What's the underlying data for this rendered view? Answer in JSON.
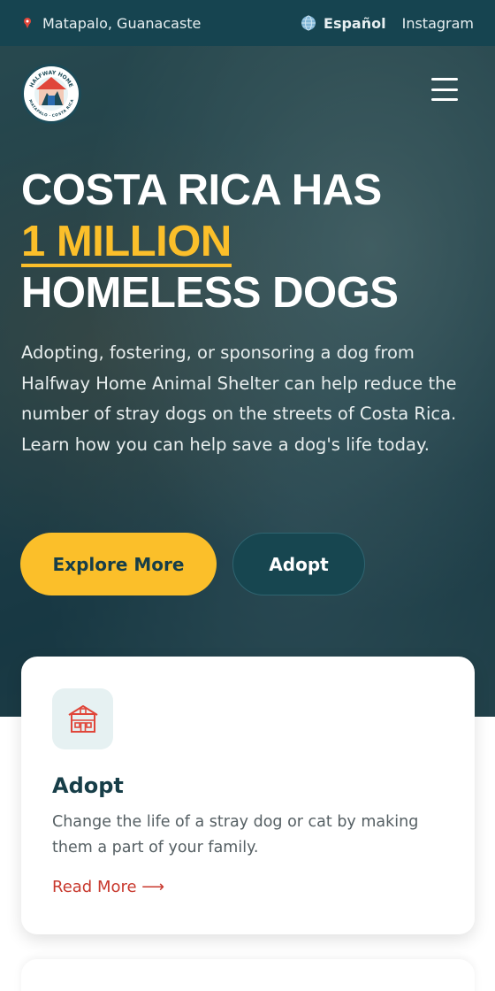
{
  "topbar": {
    "location": "Matapalo, Guanacaste",
    "language": "Español",
    "social": "Instagram"
  },
  "logo": {
    "top_text": "HALFWAY HOME",
    "bottom_text": "MATAPALO · COSTA RICA"
  },
  "hero": {
    "headline_line1": "COSTA RICA HAS",
    "headline_accent": "1 MILLION",
    "headline_line3": "HOMELESS DOGS",
    "description": "Adopting, fostering, or sponsoring a dog from Halfway Home Animal Shelter can help reduce the number of stray dogs on the streets of Costa Rica. Learn how you can help save a dog's life today.",
    "primary_button": "Explore More",
    "secondary_button": "Adopt"
  },
  "card": {
    "icon": "shelter-icon",
    "title": "Adopt",
    "text": "Change the life of a stray dog or cat by making them a part of your family.",
    "link": "Read More ⟶"
  },
  "colors": {
    "topbar": "#164450",
    "accent": "#fbbf2a",
    "link": "#c8382d",
    "dark": "#173e48"
  }
}
